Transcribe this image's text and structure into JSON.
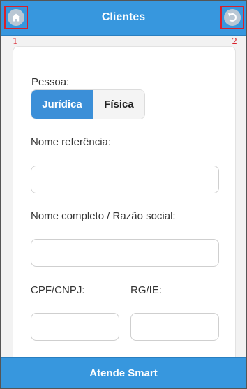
{
  "header": {
    "title": "Clientes",
    "home_icon": "home-icon",
    "back_icon": "undo-icon",
    "marker_left": "1",
    "marker_right": "2"
  },
  "form": {
    "pessoa_label": "Pessoa:",
    "pessoa_options": [
      {
        "label": "Jurídica",
        "selected": true
      },
      {
        "label": "Física",
        "selected": false
      }
    ],
    "nome_referencia_label": "Nome referência:",
    "nome_referencia_value": "",
    "nome_completo_label": "Nome completo / Razão social:",
    "nome_completo_value": "",
    "cpf_label": "CPF/CNPJ:",
    "cpf_value": "",
    "rg_label": "RG/IE:",
    "rg_value": ""
  },
  "footer": {
    "label": "Atende Smart"
  },
  "colors": {
    "primary": "#3797de",
    "selected_segment": "#3b8fd8",
    "marker": "#d8202a"
  }
}
